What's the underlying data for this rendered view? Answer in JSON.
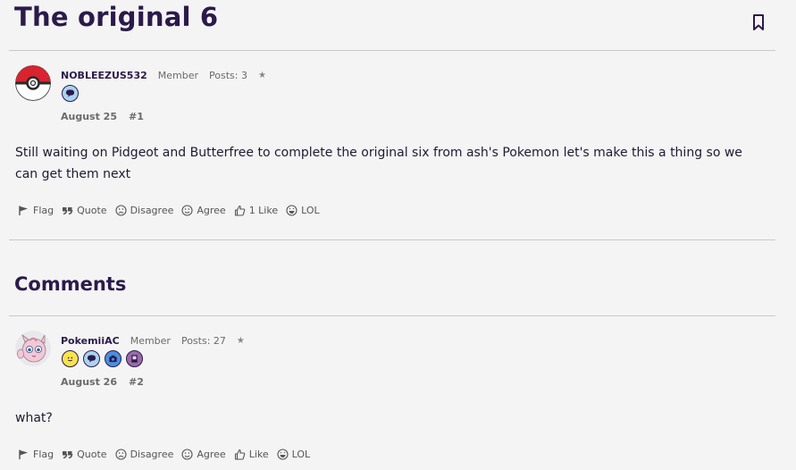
{
  "thread": {
    "title": "The original 6"
  },
  "comments_heading": "Comments",
  "posts": [
    {
      "username": "NOBLEEZUS532",
      "role": "Member",
      "posts_label": "Posts: 3",
      "star": "★",
      "date": "August 25",
      "number": "#1",
      "body": "Still waiting on Pidgeot and Butterfree to complete the original six from ash's Pokemon let's make this a thing so we can get them next",
      "actions": {
        "flag": "Flag",
        "quote": "Quote",
        "disagree": "Disagree",
        "agree": "Agree",
        "like": "1 Like",
        "lol": "LOL"
      }
    },
    {
      "username": "PokemiiAC",
      "role": "Member",
      "posts_label": "Posts: 27",
      "star": "★",
      "date": "August 26",
      "number": "#2",
      "body": "what?",
      "actions": {
        "flag": "Flag",
        "quote": "Quote",
        "disagree": "Disagree",
        "agree": "Agree",
        "like": "Like",
        "lol": "LOL"
      }
    }
  ],
  "colors": {
    "accent": "#2b1a4a",
    "background": "#f4f4f4",
    "divider": "#c9c9c9"
  }
}
